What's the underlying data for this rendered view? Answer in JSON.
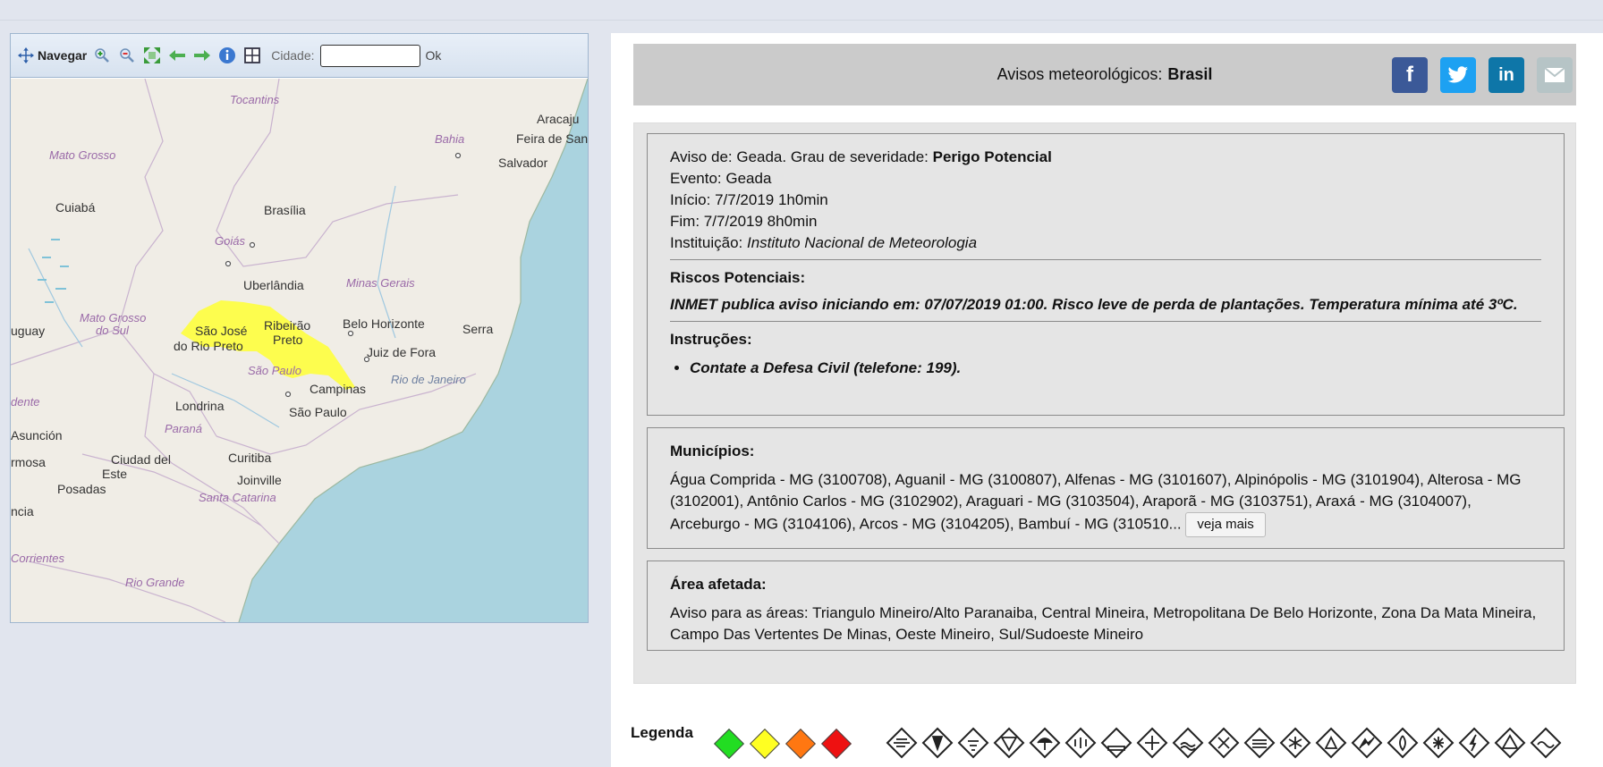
{
  "toolbar": {
    "navigate_label": "Navegar",
    "city_label": "Cidade:",
    "city_value": "",
    "ok_label": "Ok"
  },
  "map": {
    "cities": [
      "Tocantins",
      "Aracaju",
      "Bahia",
      "Feira de San",
      "Mato Grosso",
      "Salvador",
      "Cuiabá",
      "Brasília",
      "Goiás",
      "Minas Gerais",
      "Uberlândia",
      "Mato Grosso",
      "do Sul",
      "São José",
      "do Rio Preto",
      "Ribeirão",
      "Preto",
      "Belo Horizonte",
      "Serra",
      "Juiz de Fora",
      "São Paulo",
      "Rio de Janeiro",
      "Campinas",
      "Londrina",
      "São Paulo",
      "uguay",
      "dente",
      "Asunción",
      "Paraná",
      "Ciudad del",
      "Este",
      "rmosa",
      "Curitiba",
      "Joinville",
      "Posadas",
      "Santa Catarina",
      "ncia",
      "Corrientes",
      "Rio Grande"
    ]
  },
  "header": {
    "title_prefix": "Avisos meteorológicos:",
    "title_bold": "Brasil"
  },
  "share": {
    "facebook": "f",
    "linkedin": "in"
  },
  "alert": {
    "aviso_prefix": "Aviso de: Geada. Grau de severidade:",
    "severity": "Perigo Potencial",
    "evento": "Evento: Geada",
    "inicio": "Início: 7/7/2019 1h0min",
    "fim": "Fim: 7/7/2019 8h0min",
    "instituicao_prefix": "Instituição:",
    "instituicao": "Instituto Nacional de Meteorologia",
    "riscos_title": "Riscos Potenciais:",
    "riscos_text": "INMET publica aviso iniciando em: 07/07/2019 01:00. Risco leve de perda de plantações. Temperatura mínima até 3ºC.",
    "instrucoes_title": "Instruções:",
    "instrucao_1": "Contate a Defesa Civil (telefone: 199)."
  },
  "municipios": {
    "title": "Municípios:",
    "text": "Água Comprida - MG (3100708), Aguanil - MG (3100807), Alfenas - MG (3101607), Alpinópolis - MG (3101904), Alterosa - MG (3102001), Antônio Carlos - MG (3102902), Araguari - MG (3103504), Araporã - MG (3103751), Araxá - MG (3104007), Arceburgo - MG (3104106), Arcos - MG (3104205), Bambuí - MG (310510...",
    "more_label": "veja mais"
  },
  "area": {
    "title": "Área afetada:",
    "text": "Aviso para as áreas: Triangulo Mineiro/Alto Paranaiba, Central Mineira, Metropolitana De Belo Horizonte, Zona Da Mata Mineira, Campo Das Vertentes De Minas, Oeste Mineiro, Sul/Sudoeste Mineiro"
  },
  "legend": {
    "title": "Legenda",
    "colors": [
      "#22dd22",
      "#ffff22",
      "#ff7711",
      "#ee1111"
    ],
    "alert_color": "#ffff33"
  }
}
